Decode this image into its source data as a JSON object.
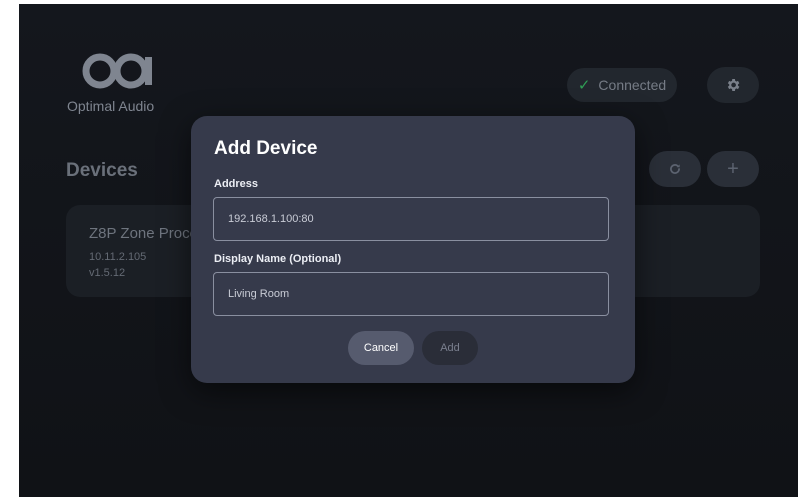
{
  "app": {
    "brand_name": "Optimal Audio",
    "status": {
      "label": "Connected",
      "icon": "check-icon",
      "color": "#2f9e55"
    },
    "toolbar": {
      "settings_icon": "gear-icon",
      "refresh_icon": "refresh-icon",
      "add_icon": "plus-icon",
      "add_symbol": "+"
    }
  },
  "devices": {
    "title": "Devices",
    "items": [
      {
        "name": "Z8P Zone Processor",
        "ip": "10.11.2.105",
        "version": "v1.5.12"
      }
    ]
  },
  "dialog": {
    "title": "Add Device",
    "address_label": "Address",
    "address_value": "192.168.1.100:80",
    "display_name_label": "Display Name (Optional)",
    "display_name_value": "Living Room",
    "cancel_label": "Cancel",
    "add_label": "Add"
  },
  "colors": {
    "accent_success": "#2f9e55",
    "dialog_bg": "#363a4b",
    "app_bg": "#14171d"
  }
}
